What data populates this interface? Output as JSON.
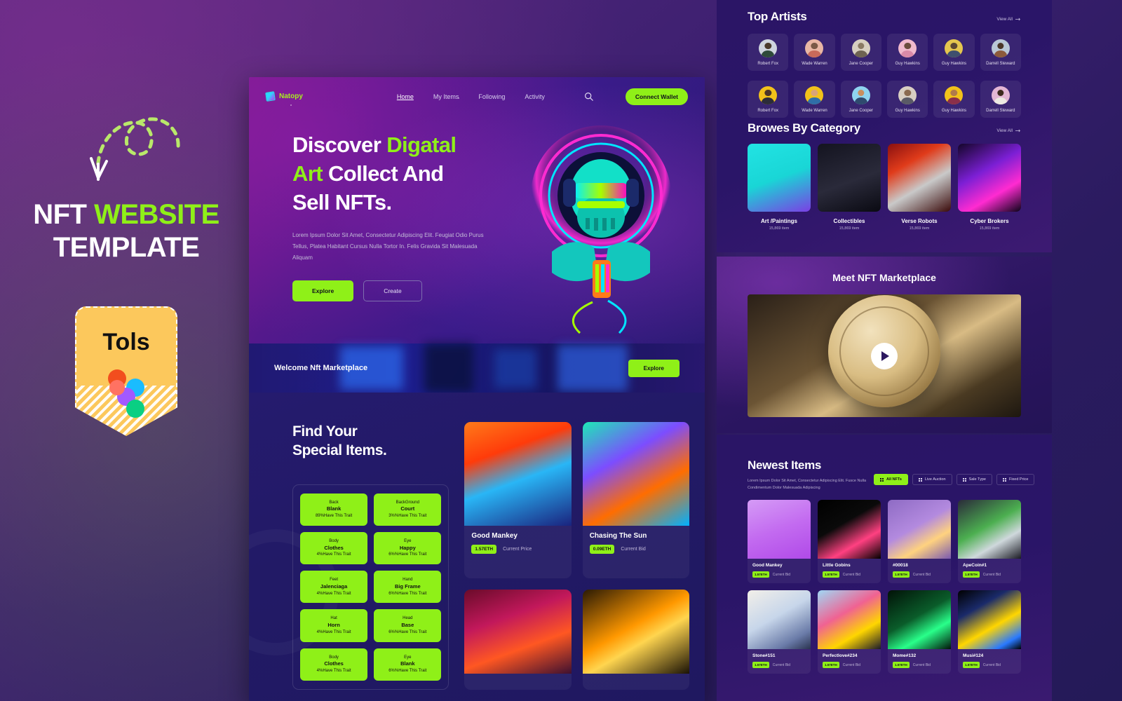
{
  "promo": {
    "title_line1_white": "NFT ",
    "title_line1_green": "WEBSITE",
    "title_line2": "TEMPLATE",
    "tag_label": "Tols",
    "arrow_icon": "curly-arrow-icon",
    "figma_icon": "figma-logo-icon"
  },
  "site": {
    "nav": {
      "logo_text": "Natopy",
      "logo_icon": "natopy-logo-icon",
      "links": [
        {
          "label": "Home",
          "active": true
        },
        {
          "label": "My Items",
          "active": false
        },
        {
          "label": "Following",
          "active": false
        },
        {
          "label": "Activity",
          "active": false
        }
      ],
      "search_icon": "search-icon",
      "wallet_label": "Connect Wallet"
    },
    "hero": {
      "h1_part1": "Discover ",
      "h1_green1": "Digatal",
      "h1_green2": "Art",
      "h1_part2": " Collect And",
      "h1_part3": "Sell NFTs.",
      "paragraph": "Lorem Ipsum Dolor Sit Amet, Consectetur Adipiscing Elit. Feugiat Odio Purus Tellus, Platea Habitant Cursus Nulla Tortor In. Felis Gravida Sit Malesuada Aliquam",
      "btn_primary": "Explore",
      "btn_secondary": "Create",
      "art_alt": "cyberpunk-skull-dj-artwork"
    },
    "welcome": {
      "text": "Welcome Nft Marketplace",
      "button": "Explore"
    },
    "special": {
      "heading_line1": "Find Your",
      "heading_line2": "Special Items.",
      "traits": [
        {
          "type": "Back",
          "value": "Blank",
          "rarity": "89%Have This Trait"
        },
        {
          "type": "BackGround",
          "value": "Court",
          "rarity": "3%%Have This Trait"
        },
        {
          "type": "Body",
          "value": "Clothes",
          "rarity": "4%Have This Trait"
        },
        {
          "type": "Eye",
          "value": "Happy",
          "rarity": "6%%Have This Trait"
        },
        {
          "type": "Feet",
          "value": "Jalenciaga",
          "rarity": "4%Have This Trait"
        },
        {
          "type": "Hand",
          "value": "Big Frame",
          "rarity": "6%%Have This Trait"
        },
        {
          "type": "Hat",
          "value": "Horn",
          "rarity": "4%Have This Trait"
        },
        {
          "type": "Head",
          "value": "Base",
          "rarity": "6%%Have This Trait"
        },
        {
          "type": "Body",
          "value": "Clothes",
          "rarity": "4%Have This Trait"
        },
        {
          "type": "Eye",
          "value": "Blank",
          "rarity": "6%%Have This Trait"
        }
      ],
      "nfts": [
        {
          "name": "Good Mankey",
          "price": "1.57ETH",
          "label": "Current Price",
          "art": "blue-ape-halo-fire"
        },
        {
          "name": "Chasing The Sun",
          "price": "0.09ETH",
          "label": "Current Bid",
          "art": "neon-creature-swirl"
        },
        {
          "name": "",
          "price": "",
          "label": "",
          "art": "red-smoke-abstract"
        },
        {
          "name": "",
          "price": "",
          "label": "",
          "art": "bitcoin-gold-glow"
        }
      ]
    }
  },
  "right": {
    "artists": {
      "title": "Top Artists",
      "view_all": "View All",
      "view_all_icon": "arrow-right-icon",
      "row1": [
        {
          "name": "Robert Fox",
          "bg": "#cfd4de",
          "head": "#4b3a2c",
          "body": "#2f4a3a"
        },
        {
          "name": "Wade Warren",
          "bg": "#e9b7a4",
          "head": "#7a5a46",
          "body": "#c96a5a"
        },
        {
          "name": "Jane Cooper",
          "bg": "#d7cfc0",
          "head": "#8a7a63",
          "body": "#6e6352"
        },
        {
          "name": "Guy Hawkins",
          "bg": "#f0b9cc",
          "head": "#6b4c3c",
          "body": "#d98aa8"
        },
        {
          "name": "Guy Hawkins",
          "bg": "#e5c64e",
          "head": "#5c4734",
          "body": "#3f4f6e"
        },
        {
          "name": "Darrell Steward",
          "bg": "#b9c7d6",
          "head": "#4a3628",
          "body": "#8c5a3c"
        }
      ],
      "row2": [
        {
          "name": "Robert Fox",
          "bg": "#f2c21a",
          "head": "#4b3528",
          "body": "#2c2c3a"
        },
        {
          "name": "Wade Warren",
          "bg": "#f2c21a",
          "head": "#d9a477",
          "body": "#2f6ea8"
        },
        {
          "name": "Jane Cooper",
          "bg": "#8fd4ef",
          "head": "#c98f5f",
          "body": "#2f4a6e"
        },
        {
          "name": "Guy Hawkins",
          "bg": "#d8cec2",
          "head": "#8a6a50",
          "body": "#5a5a66"
        },
        {
          "name": "Guy Hawkins",
          "bg": "#f2c21a",
          "head": "#b07a4a",
          "body": "#8a2f4a"
        },
        {
          "name": "Darrell Steward",
          "bg": "#e3b6d4",
          "head": "#3d2a1e",
          "body": "#ede9e2"
        }
      ]
    },
    "categories": {
      "title": "Browes By Category",
      "view_all": "View All",
      "items": [
        {
          "name": "Art /Paintings",
          "count": "15,869 item",
          "art": "cyan-robot-hand"
        },
        {
          "name": "Collectibles",
          "count": "15,869 item",
          "art": "dark-villain-figure"
        },
        {
          "name": "Verse Robots",
          "count": "15,869 item",
          "art": "red-mech-parts"
        },
        {
          "name": "Cyber Brokers",
          "count": "15,869 item",
          "art": "neon-chip-stack"
        }
      ]
    },
    "video": {
      "title": "Meet NFT Marketplace",
      "play_icon": "play-icon",
      "art": "gold-crypto-coins"
    },
    "newest": {
      "title": "Newest Items",
      "subtitle": "Lorem Ipsum Dolor Sit Amet, Consectetur Adipiscing Elit. Fusce Nulla Condimentum Dolor Malesuada Adipiscing",
      "filters": [
        {
          "label": "All NFTs",
          "active": true
        },
        {
          "label": "Live Auction",
          "active": false
        },
        {
          "label": "Sale Type",
          "active": false
        },
        {
          "label": "Fixed Price",
          "active": false
        }
      ],
      "items": [
        {
          "name": "Good Mankey",
          "price": "1.57ETH",
          "label": "Current Bid",
          "art": "pixel-mask-purple"
        },
        {
          "name": "Little Gobins",
          "price": "1.57ETH",
          "label": "Current Bid",
          "art": "pink-goblin-black"
        },
        {
          "name": "#00018",
          "price": "1.57ETH",
          "label": "Current Bid",
          "art": "gold-figure-purple"
        },
        {
          "name": "ApeCoin#1",
          "price": "1.57ETH",
          "label": "Current Bid",
          "art": "green-astronaut-ape"
        },
        {
          "name": "Stone#151",
          "price": "1.57ETH",
          "label": "Current Bid",
          "art": "white-blue-sculpture"
        },
        {
          "name": "Perfectlove#234",
          "price": "1.57ETH",
          "label": "Current Bid",
          "art": "pink-hair-cyber-girl"
        },
        {
          "name": "Mome#132",
          "price": "1.57ETH",
          "label": "Current Bid",
          "art": "green-neon-face"
        },
        {
          "name": "Musi#124",
          "price": "1.57ETH",
          "label": "Current Bid",
          "art": "yellow-blue-mask"
        }
      ]
    }
  },
  "colors": {
    "accent_green": "#8ff018",
    "tag_yellow": "#fcc85c",
    "bg_purple": "#3a1f6e",
    "panel_indigo": "#2a1568"
  }
}
